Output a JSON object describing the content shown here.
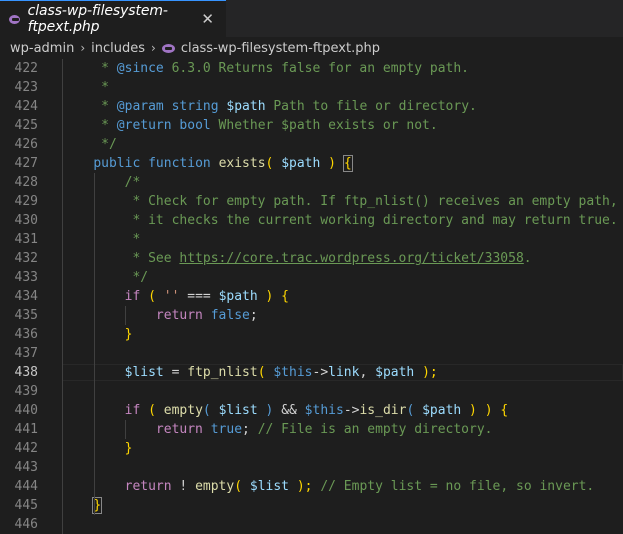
{
  "tab": {
    "title": "class-wp-filesystem-ftpext.php",
    "close": "✕",
    "icon": "php-file-icon"
  },
  "breadcrumb": {
    "items": [
      "wp-admin",
      "includes"
    ],
    "file": "class-wp-filesystem-ftpext.php",
    "separator": "›"
  },
  "editor": {
    "active_line": 438,
    "lines": [
      {
        "n": 422,
        "s": [
          {
            "t": "     * ",
            "c": "c"
          },
          {
            "t": "@since",
            "c": "k"
          },
          {
            "t": " 6.3.0 Returns false for an empty path.",
            "c": "c"
          }
        ]
      },
      {
        "n": 423,
        "s": [
          {
            "t": "     *",
            "c": "c"
          }
        ]
      },
      {
        "n": 424,
        "s": [
          {
            "t": "     * ",
            "c": "c"
          },
          {
            "t": "@param",
            "c": "k"
          },
          {
            "t": " ",
            "c": "c"
          },
          {
            "t": "string",
            "c": "k"
          },
          {
            "t": " ",
            "c": "c"
          },
          {
            "t": "$path",
            "c": "v"
          },
          {
            "t": " Path to file or directory.",
            "c": "c"
          }
        ]
      },
      {
        "n": 425,
        "s": [
          {
            "t": "     * ",
            "c": "c"
          },
          {
            "t": "@return",
            "c": "k"
          },
          {
            "t": " ",
            "c": "c"
          },
          {
            "t": "bool",
            "c": "k"
          },
          {
            "t": " Whether $path exists or not.",
            "c": "c"
          }
        ]
      },
      {
        "n": 426,
        "s": [
          {
            "t": "     */",
            "c": "c"
          }
        ]
      },
      {
        "n": 427,
        "s": [
          {
            "t": "    ",
            "c": ""
          },
          {
            "t": "public",
            "c": "k"
          },
          {
            "t": " ",
            "c": ""
          },
          {
            "t": "function",
            "c": "k"
          },
          {
            "t": " ",
            "c": ""
          },
          {
            "t": "exists",
            "c": "f"
          },
          {
            "t": "( ",
            "c": "y"
          },
          {
            "t": "$path",
            "c": "v"
          },
          {
            "t": " ) ",
            "c": "y"
          },
          {
            "t": "{",
            "c": "y bm"
          }
        ]
      },
      {
        "n": 428,
        "s": [
          {
            "t": "        /*",
            "c": "c"
          }
        ]
      },
      {
        "n": 429,
        "s": [
          {
            "t": "         * Check for empty path. If ftp_nlist() receives an empty path,",
            "c": "c"
          }
        ]
      },
      {
        "n": 430,
        "s": [
          {
            "t": "         * it checks the current working directory and may return true.",
            "c": "c"
          }
        ]
      },
      {
        "n": 431,
        "s": [
          {
            "t": "         *",
            "c": "c"
          }
        ]
      },
      {
        "n": 432,
        "s": [
          {
            "t": "         * See ",
            "c": "c"
          },
          {
            "t": "https://core.trac.wordpress.org/ticket/33058",
            "c": "link"
          },
          {
            "t": ".",
            "c": "c"
          }
        ]
      },
      {
        "n": 433,
        "s": [
          {
            "t": "         */",
            "c": "c"
          }
        ]
      },
      {
        "n": 434,
        "s": [
          {
            "t": "        ",
            "c": ""
          },
          {
            "t": "if",
            "c": "kw"
          },
          {
            "t": " ( ",
            "c": "y"
          },
          {
            "t": "''",
            "c": "s"
          },
          {
            "t": " === ",
            "c": ""
          },
          {
            "t": "$path",
            "c": "v"
          },
          {
            "t": " ) {",
            "c": "y"
          }
        ]
      },
      {
        "n": 435,
        "s": [
          {
            "t": "            ",
            "c": ""
          },
          {
            "t": "return",
            "c": "kw"
          },
          {
            "t": " ",
            "c": ""
          },
          {
            "t": "false",
            "c": "k"
          },
          {
            "t": ";",
            "c": ""
          }
        ]
      },
      {
        "n": 436,
        "s": [
          {
            "t": "        }",
            "c": "y"
          }
        ]
      },
      {
        "n": 437,
        "s": []
      },
      {
        "n": 438,
        "s": [
          {
            "t": "        ",
            "c": ""
          },
          {
            "t": "$list",
            "c": "v"
          },
          {
            "t": " = ",
            "c": ""
          },
          {
            "t": "ftp_nlist",
            "c": "f"
          },
          {
            "t": "( ",
            "c": "y"
          },
          {
            "t": "$this",
            "c": "k"
          },
          {
            "t": "->",
            "c": ""
          },
          {
            "t": "link",
            "c": "v"
          },
          {
            "t": ", ",
            "c": ""
          },
          {
            "t": "$path",
            "c": "v"
          },
          {
            "t": " );",
            "c": "y"
          }
        ]
      },
      {
        "n": 439,
        "s": []
      },
      {
        "n": 440,
        "s": [
          {
            "t": "        ",
            "c": ""
          },
          {
            "t": "if",
            "c": "kw"
          },
          {
            "t": " ( ",
            "c": "y"
          },
          {
            "t": "empty",
            "c": "f"
          },
          {
            "t": "( ",
            "c": "k"
          },
          {
            "t": "$list",
            "c": "v"
          },
          {
            "t": " ) ",
            "c": "k"
          },
          {
            "t": "&& ",
            "c": ""
          },
          {
            "t": "$this",
            "c": "k"
          },
          {
            "t": "->",
            "c": ""
          },
          {
            "t": "is_dir",
            "c": "f"
          },
          {
            "t": "( ",
            "c": "k"
          },
          {
            "t": "$path",
            "c": "v"
          },
          {
            "t": " ) ) {",
            "c": "y"
          }
        ]
      },
      {
        "n": 441,
        "s": [
          {
            "t": "            ",
            "c": ""
          },
          {
            "t": "return",
            "c": "kw"
          },
          {
            "t": " ",
            "c": ""
          },
          {
            "t": "true",
            "c": "k"
          },
          {
            "t": "; ",
            "c": ""
          },
          {
            "t": "// File is an empty directory.",
            "c": "c"
          }
        ]
      },
      {
        "n": 442,
        "s": [
          {
            "t": "        }",
            "c": "y"
          }
        ]
      },
      {
        "n": 443,
        "s": []
      },
      {
        "n": 444,
        "s": [
          {
            "t": "        ",
            "c": ""
          },
          {
            "t": "return",
            "c": "kw"
          },
          {
            "t": " ! ",
            "c": ""
          },
          {
            "t": "empty",
            "c": "f"
          },
          {
            "t": "( ",
            "c": "y"
          },
          {
            "t": "$list",
            "c": "v"
          },
          {
            "t": " ); ",
            "c": "y"
          },
          {
            "t": "// Empty list = no file, so invert.",
            "c": "c"
          }
        ]
      },
      {
        "n": 445,
        "s": [
          {
            "t": "    ",
            "c": ""
          },
          {
            "t": "}",
            "c": "y bm"
          }
        ]
      },
      {
        "n": 446,
        "s": []
      }
    ]
  }
}
